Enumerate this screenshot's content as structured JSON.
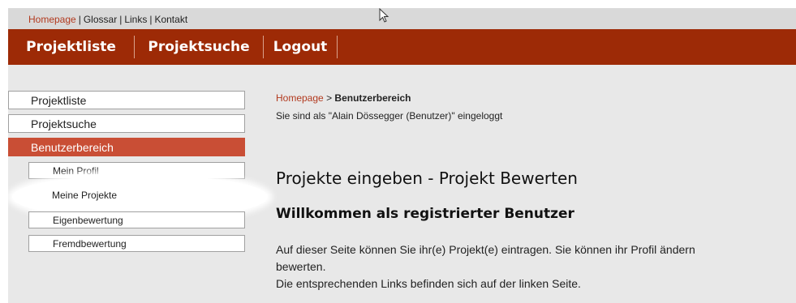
{
  "toplinks": {
    "items": [
      "Homepage",
      "Glossar",
      "Links",
      "Kontakt"
    ],
    "separator": "|"
  },
  "mainnav": {
    "items": [
      "Projektliste",
      "Projektsuche",
      "Logout"
    ]
  },
  "sidebar": {
    "items": [
      "Projektliste",
      "Projektsuche",
      "Benutzerbereich"
    ],
    "subitems": [
      "Mein Profil",
      "Meine Projekte",
      "Eigenbewertung",
      "Fremdbewertung"
    ]
  },
  "content": {
    "breadcrumb_home": "Homepage",
    "breadcrumb_sep": ">",
    "breadcrumb_current": "Benutzerbereich",
    "logged_in": "Sie sind als \"Alain Dössegger (Benutzer)\" eingeloggt",
    "title": "Projekte eingeben - Projekt Bewerten",
    "welcome": "Willkommen als registrierter Benutzer",
    "para_line1": "Auf dieser Seite können Sie ihr(e) Projekt(e) eintragen. Sie können ihr Profil ändern",
    "para_line2": "bewerten.",
    "para_line3": "Die entsprechenden Links befinden sich auf der linken Seite."
  },
  "colors": {
    "nav_bg": "#9d2a06",
    "active_sidebar": "#c94e35",
    "link_red": "#b23a1f"
  },
  "icons": [
    "mouse-cursor-icon"
  ]
}
